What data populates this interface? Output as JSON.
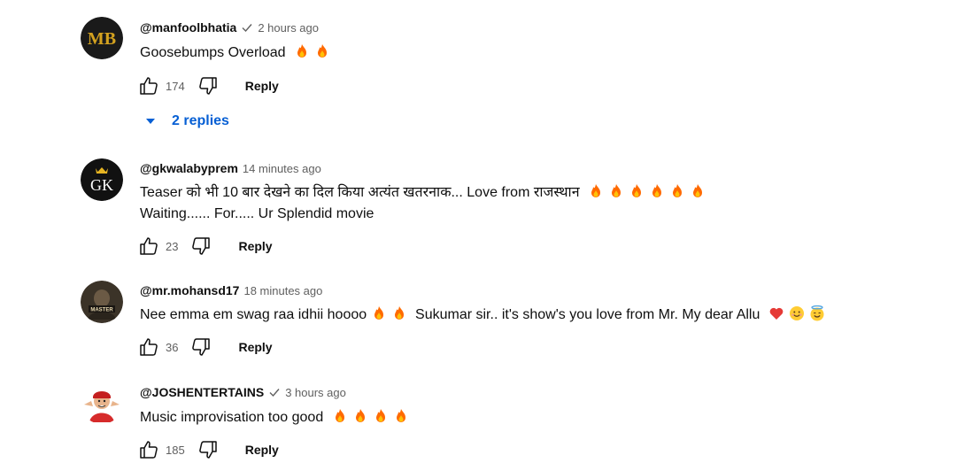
{
  "comments": [
    {
      "author": "@manfoolbhatia",
      "verified": true,
      "time": "2 hours ago",
      "lines": [
        "Goosebumps Overload"
      ],
      "emojis": [
        "fire",
        "fire"
      ],
      "likes": "174",
      "reply_label": "Reply",
      "replies_label": "2 replies",
      "avatar_text": "MB"
    },
    {
      "author": "@gkwalabyprem",
      "verified": false,
      "time": "14 minutes ago",
      "lines": [
        "Teaser को भी 10 बार देखने का दिल किया अत्यंत खतरनाक... Love from राजस्थान",
        "Waiting...... For..... Ur Splendid movie"
      ],
      "emojis": [
        "fire",
        "fire",
        "fire",
        "fire",
        "fire",
        "fire"
      ],
      "likes": "23",
      "reply_label": "Reply",
      "avatar_text": "GK"
    },
    {
      "author": "@mr.mohansd17",
      "verified": false,
      "time": "18 minutes ago",
      "lines": [
        "Nee emma em swag raa idhii hoooo",
        "Sukumar sir.. it's show's you love from Mr. My dear Allu"
      ],
      "emojis": [
        "fire",
        "fire",
        "heart",
        "smile",
        "halo"
      ],
      "likes": "36",
      "reply_label": "Reply",
      "avatar_text": "MASTER"
    },
    {
      "author": "@JOSHENTERTAINS",
      "verified": true,
      "time": "3 hours ago",
      "lines": [
        "Music improvisation too good"
      ],
      "emojis": [
        "fire",
        "fire",
        "fire",
        "fire"
      ],
      "likes": "185",
      "reply_label": "Reply"
    }
  ],
  "colors": {
    "link": "#065fd4",
    "secondary": "#606060",
    "fire": "#ff6a00",
    "heart": "#e53935"
  }
}
